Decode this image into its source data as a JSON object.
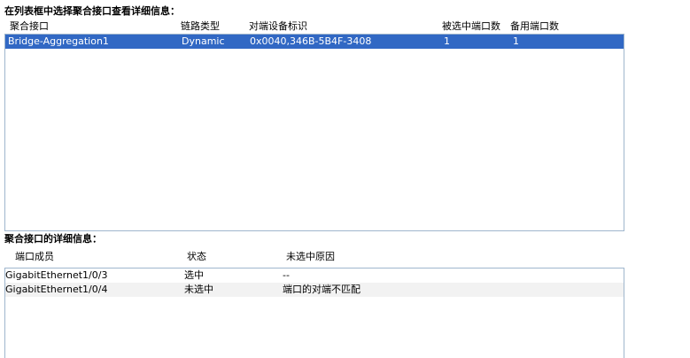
{
  "aggregation_section": {
    "title": "在列表框中选择聚合接口查看详细信息：",
    "columns": [
      "聚合接口",
      "链路类型",
      "对端设备标识",
      "被选中端口数",
      "备用端口数"
    ],
    "rows": [
      {
        "interface": "Bridge-Aggregation1",
        "link_type": "Dynamic",
        "peer_id": "0x0040,346B-5B4F-3408",
        "selected_ports": "1",
        "standby_ports": "1"
      }
    ]
  },
  "detail_section": {
    "title": "聚合接口的详细信息：",
    "columns": [
      "端口成员",
      "状态",
      "未选中原因"
    ],
    "rows": [
      {
        "member": "GigabitEthernet1/0/3",
        "status": "选中",
        "reason": "--"
      },
      {
        "member": "GigabitEthernet1/0/4",
        "status": "未选中",
        "reason": "端口的对端不匹配"
      }
    ]
  },
  "colors": {
    "selection": "#3168c4",
    "border": "#9fb6cd",
    "alt_row": "#f2f2f2"
  }
}
